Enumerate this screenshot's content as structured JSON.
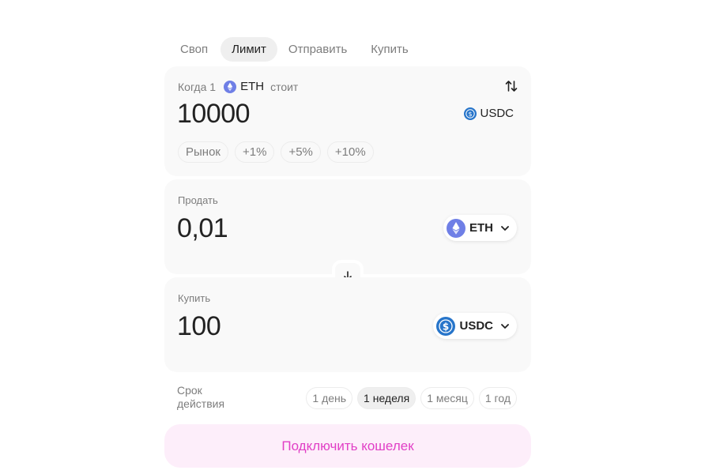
{
  "tabs": [
    {
      "label": "Своп",
      "active": false
    },
    {
      "label": "Лимит",
      "active": true
    },
    {
      "label": "Отправить",
      "active": false
    },
    {
      "label": "Купить",
      "active": false
    }
  ],
  "limit": {
    "when_prefix": "Когда 1",
    "base_token": "ETH",
    "costs_label": "стоит",
    "price": "10000",
    "quote_token": "USDC",
    "presets": [
      "Рынок",
      "+1%",
      "+5%",
      "+10%"
    ]
  },
  "sell": {
    "label": "Продать",
    "amount": "0,01",
    "token": "ETH"
  },
  "buy": {
    "label": "Купить",
    "amount": "100",
    "token": "USDC"
  },
  "expiry": {
    "label_line1": "Срок",
    "label_line2": "действия",
    "options": [
      "1 день",
      "1 неделя",
      "1 месяц",
      "1 год"
    ],
    "selected_index": 1
  },
  "connect_label": "Подключить кошелек",
  "colors": {
    "accent": "#e140c6",
    "accent_bg": "#fdeefa",
    "eth": "#6f7fe6",
    "usdc": "#2775ca"
  },
  "icons": {
    "swap_direction": "arrows-up-down-icon",
    "flip": "arrow-down-icon",
    "dropdown": "chevron-down-icon"
  }
}
